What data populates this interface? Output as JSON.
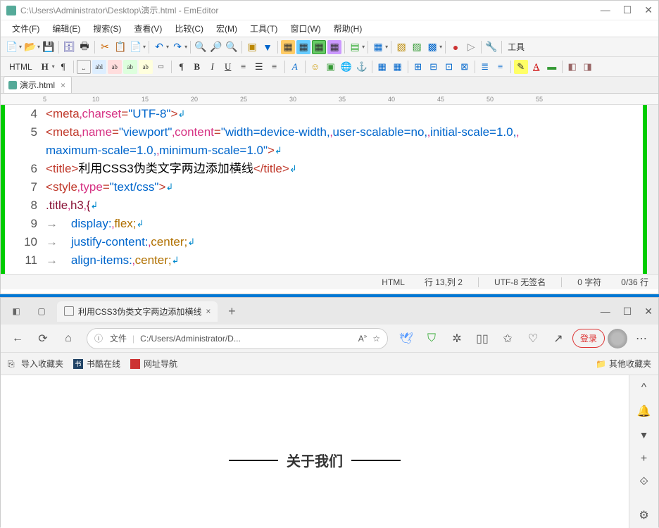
{
  "editor": {
    "title": "C:\\Users\\Administrator\\Desktop\\演示.html - EmEditor",
    "menus": [
      "文件(F)",
      "编辑(E)",
      "搜索(S)",
      "查看(V)",
      "比较(C)",
      "宏(M)",
      "工具(T)",
      "窗口(W)",
      "帮助(H)"
    ],
    "toolbar_right": "工具",
    "format_label": "HTML",
    "tab": {
      "name": "演示.html"
    },
    "ruler": [
      "5",
      "10",
      "15",
      "20",
      "25",
      "30",
      "35",
      "40",
      "45",
      "50",
      "55"
    ],
    "lines": {
      "start": 4,
      "nums": [
        "4",
        "5",
        "6",
        "7",
        "8",
        "9",
        "10",
        "11"
      ]
    },
    "code": {
      "l4": {
        "tag": "meta",
        "attr": "charset",
        "val": "\"UTF-8\""
      },
      "l5": {
        "tag": "meta",
        "attr1": "name",
        "val1": "\"viewport\"",
        "attr2": "content",
        "val2": "\"width=device-width,",
        "val2b": "user-scalable=no,",
        "val2c": "initial-scale=1.0,"
      },
      "l5b": {
        "val": "maximum-scale=1.0,",
        "val2": "minimum-scale=1.0\""
      },
      "l6": {
        "tag": "title",
        "text": "利用CSS3伪类文字两边添加横线",
        "closetag": "/title"
      },
      "l7": {
        "tag": "style",
        "attr": "type",
        "val": "\"text/css\""
      },
      "l8": {
        "sel": ".title",
        "sel2": "h3"
      },
      "l9": {
        "prop": "display:",
        "val": "flex;"
      },
      "l10": {
        "prop": "justify-content:",
        "val": "center;"
      },
      "l11": {
        "prop": "align-items:",
        "val": "center;"
      }
    },
    "status": {
      "lang": "HTML",
      "pos": "行 13,列 2",
      "encoding": "UTF-8 无签名",
      "chars": "0 字符",
      "lines": "0/36 行"
    }
  },
  "browser": {
    "tab_title": "利用CSS3伪类文字两边添加横线",
    "url_label": "文件",
    "url_path": "C:/Users/Administrator/D...",
    "login": "登录",
    "bookmarks": {
      "import": "导入收藏夹",
      "b1": "书酷在线",
      "b2": "网址导航",
      "other": "其他收藏夹"
    },
    "page_heading": "关于我们"
  }
}
